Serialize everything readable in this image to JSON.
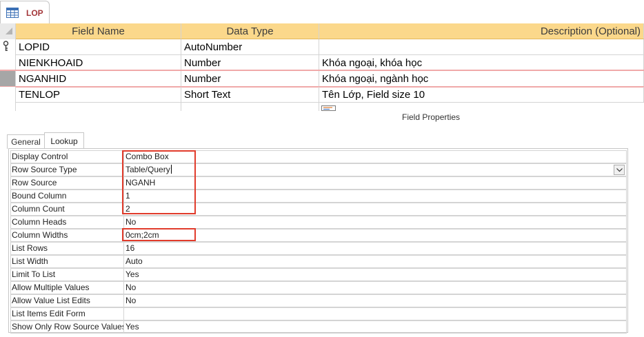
{
  "tab": {
    "label": "LOP",
    "icon": "table-icon"
  },
  "design_grid": {
    "headers": [
      "Field Name",
      "Data Type",
      "Description (Optional)"
    ],
    "rows": [
      {
        "field": "LOPID",
        "type": "AutoNumber",
        "description": "",
        "primary_key": true
      },
      {
        "field": "NIENKHOAID",
        "type": "Number",
        "description": "Khóa ngoại, khóa học"
      },
      {
        "field": "NGANHID",
        "type": "Number",
        "description": "Khóa ngoại, ngành học",
        "selected": true
      },
      {
        "field": "TENLOP",
        "type": "Short Text",
        "description": "Tên Lớp, Field size 10"
      },
      {
        "field": "",
        "type": "",
        "description": ""
      }
    ]
  },
  "field_properties": {
    "title": "Field Properties",
    "tabs": [
      "General",
      "Lookup"
    ],
    "active_tab": "Lookup",
    "rows": [
      {
        "name": "Display Control",
        "value": "Combo Box"
      },
      {
        "name": "Row Source Type",
        "value": "Table/Query"
      },
      {
        "name": "Row Source",
        "value": "NGANH"
      },
      {
        "name": "Bound Column",
        "value": "1"
      },
      {
        "name": "Column Count",
        "value": "2"
      },
      {
        "name": "Column Heads",
        "value": "No"
      },
      {
        "name": "Column Widths",
        "value": "0cm;2cm"
      },
      {
        "name": "List Rows",
        "value": "16"
      },
      {
        "name": "List Width",
        "value": "Auto"
      },
      {
        "name": "Limit To List",
        "value": "Yes"
      },
      {
        "name": "Allow Multiple Values",
        "value": "No"
      },
      {
        "name": "Allow Value List Edits",
        "value": "No"
      },
      {
        "name": "List Items Edit Form",
        "value": ""
      },
      {
        "name": "Show Only Row Source Values",
        "value": "Yes"
      }
    ]
  },
  "colors": {
    "header_bg": "#fbd88b",
    "tab_label": "#a4373a",
    "highlight": "#e13b2b",
    "selected_row_line": "#f0a9a9"
  }
}
